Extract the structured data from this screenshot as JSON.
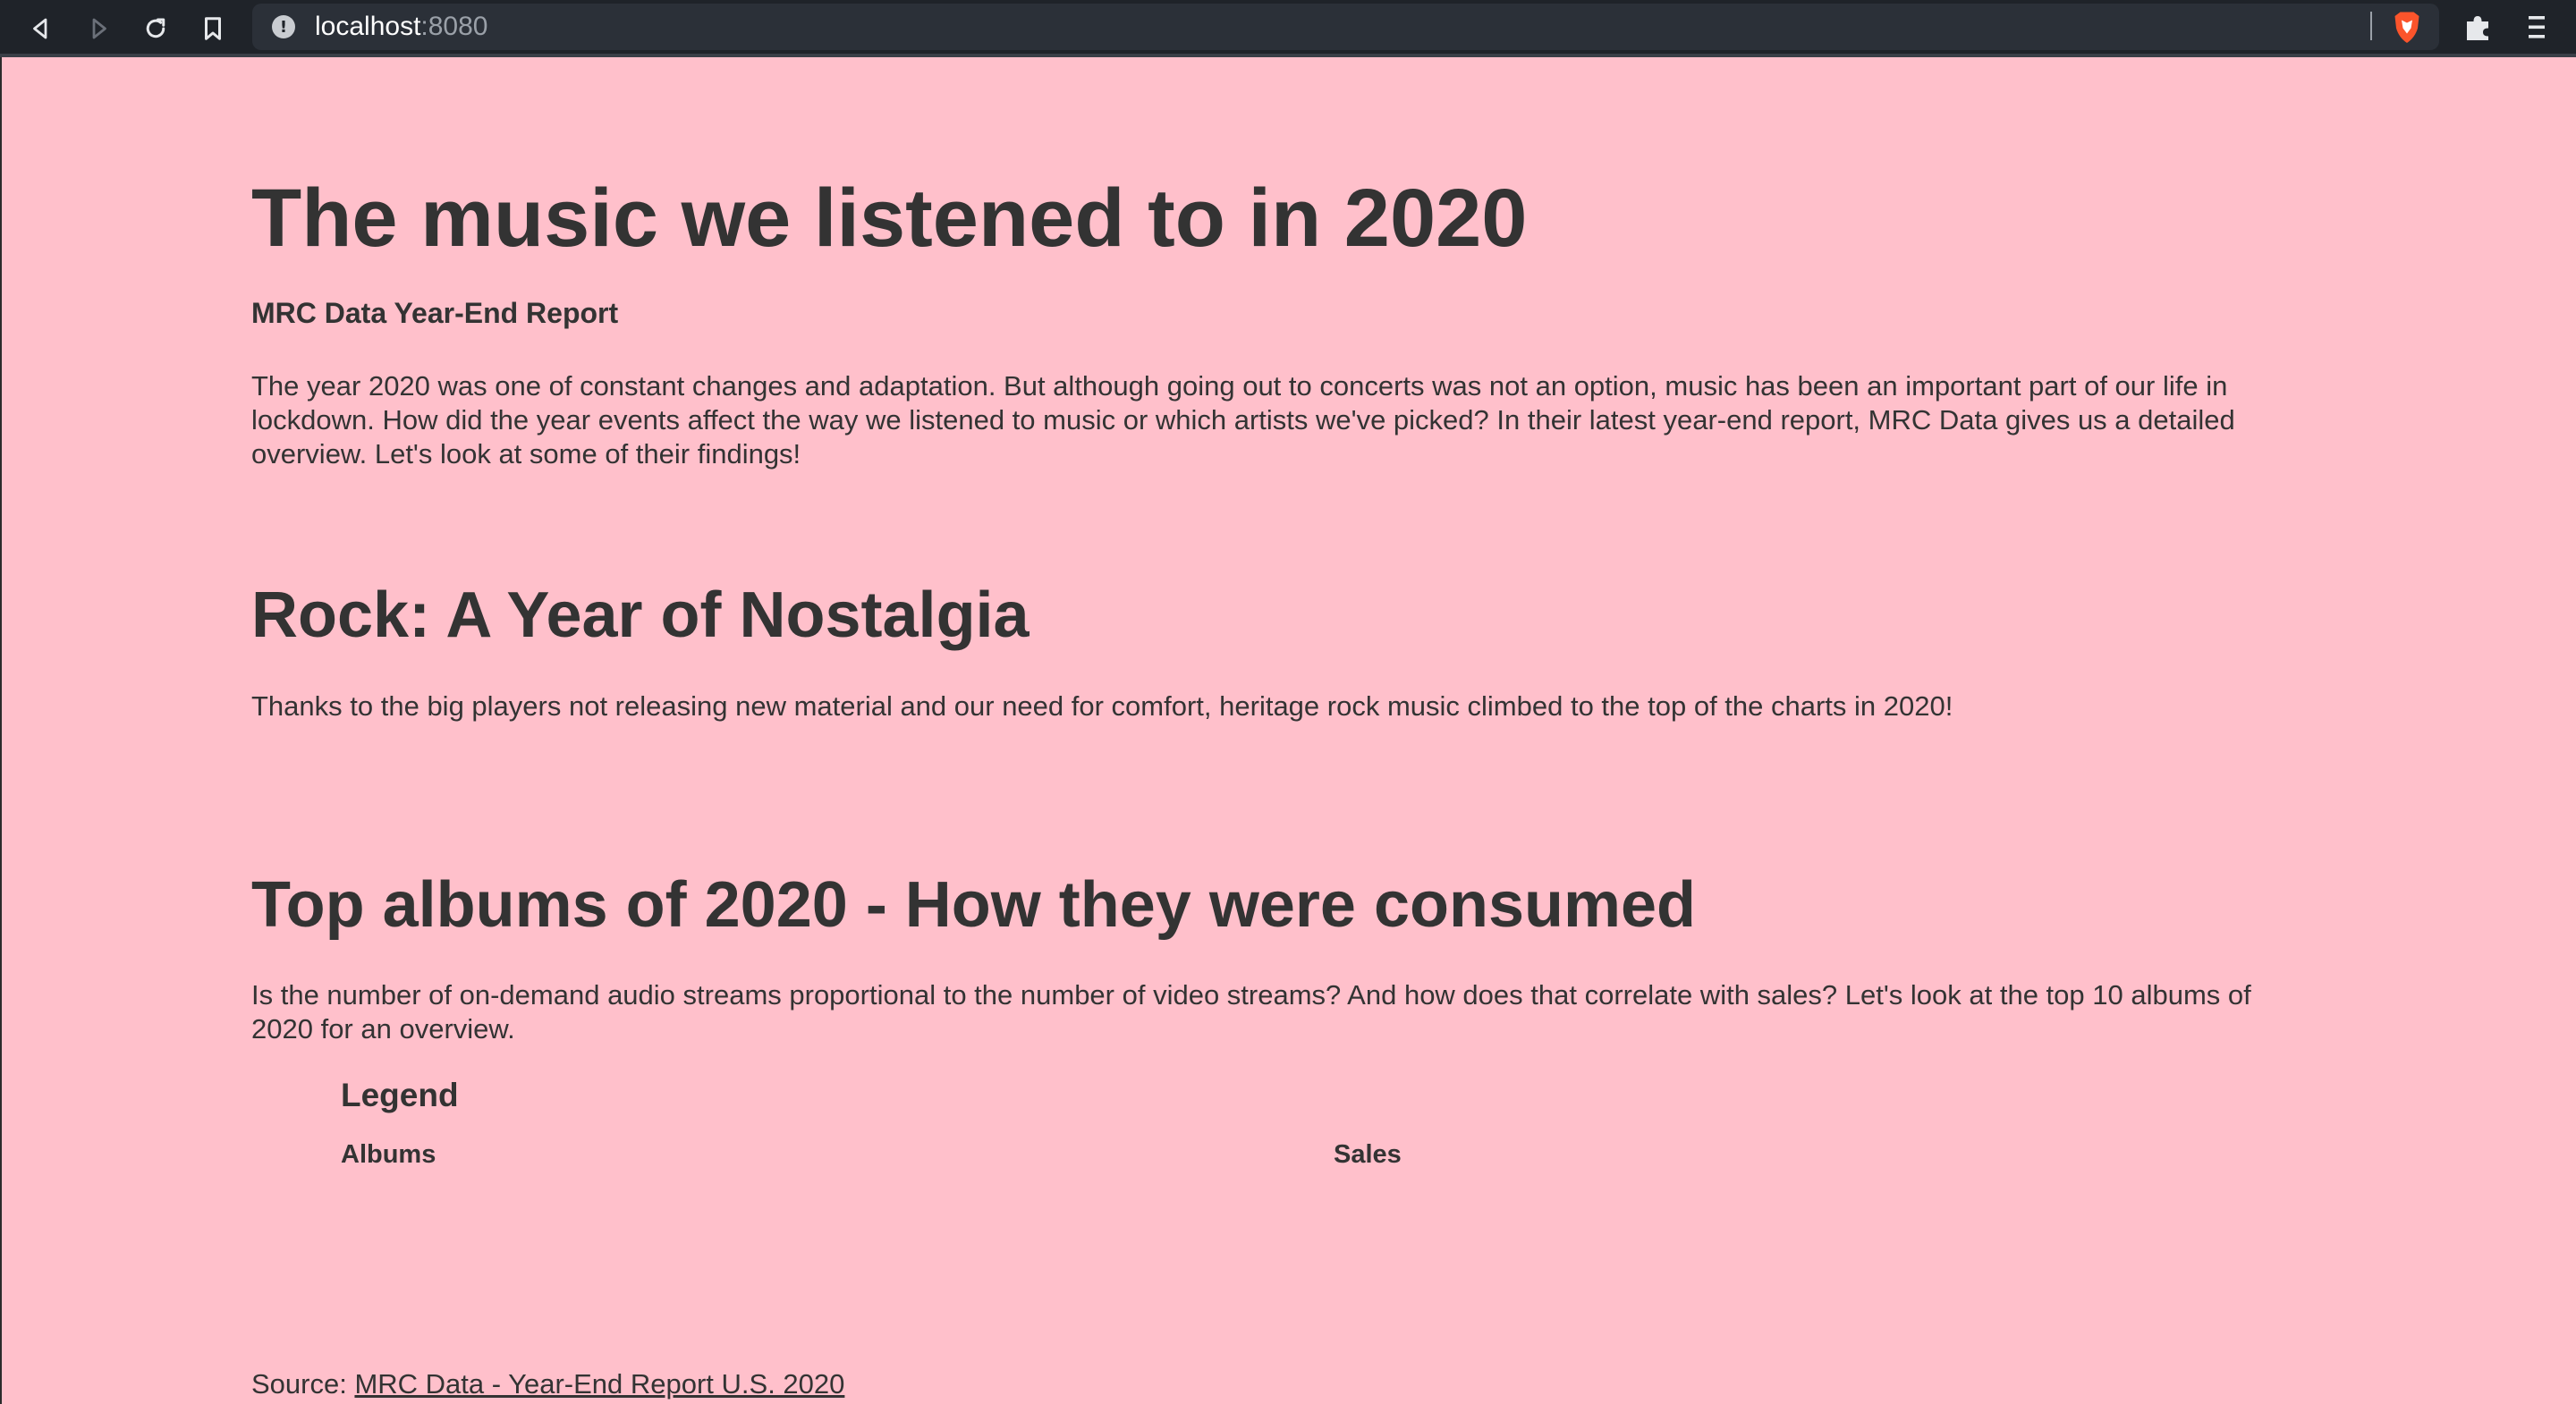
{
  "browser": {
    "url_host": "localhost",
    "url_port": ":8080"
  },
  "page": {
    "title": "The music we listened to in 2020",
    "subtitle": "MRC Data Year-End Report",
    "intro": "The year 2020 was one of constant changes and adaptation. But although going out to concerts was not an option, music has been an important part of our life in lockdown. How did the year events affect the way we listened to music or which artists we've picked? In their latest year-end report, MRC Data gives us a detailed overview. Let's look at some of their findings!",
    "rock_section": {
      "title": "Rock: A Year of Nostalgia",
      "text": "Thanks to the big players not releasing new material and our need for comfort, heritage rock music climbed to the top of the charts in 2020!"
    },
    "albums_section": {
      "title": "Top albums of 2020 - How they were consumed",
      "text": "Is the number of on-demand audio streams proportional to the number of video streams? And how does that correlate with sales? Let's look at the top 10 albums of 2020 for an overview.",
      "legend_title": "Legend",
      "legend_albums": "Albums",
      "legend_sales": "Sales"
    },
    "source_prefix": "Source: ",
    "source_link": "MRC Data - Year-End Report U.S. 2020"
  },
  "colors": {
    "page_background": "#ffc0cb",
    "text": "#333333",
    "browser_bar": "#1f2329"
  }
}
